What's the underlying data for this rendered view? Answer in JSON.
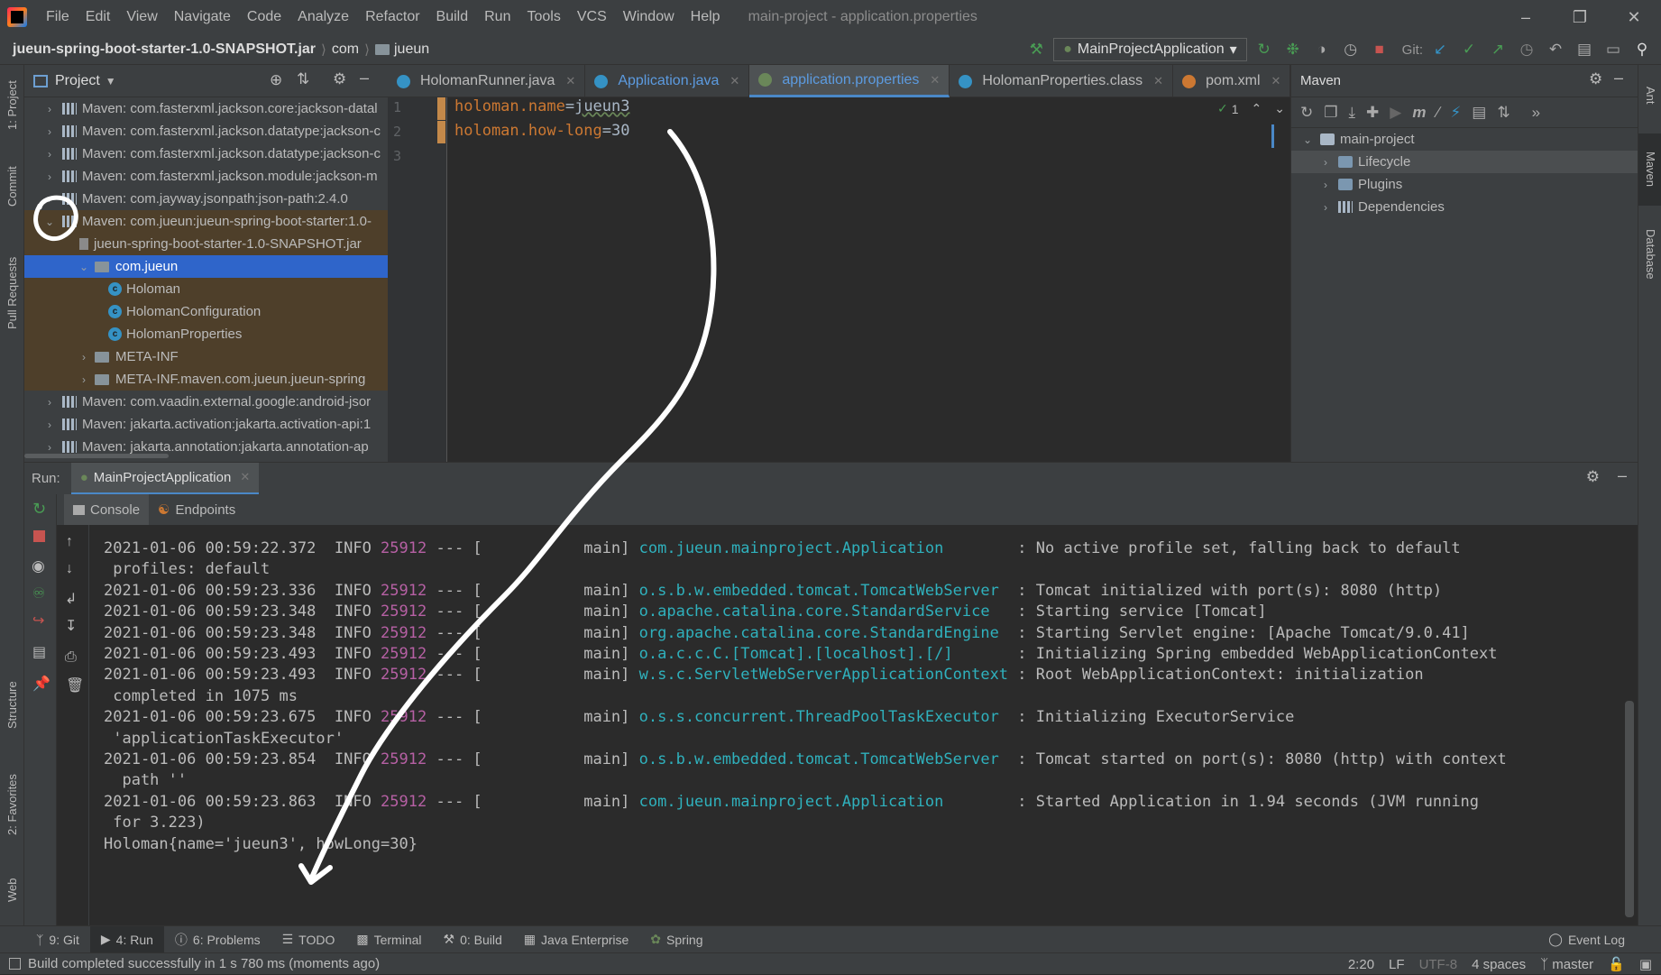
{
  "menubar": {
    "items": [
      "File",
      "Edit",
      "View",
      "Navigate",
      "Code",
      "Analyze",
      "Refactor",
      "Build",
      "Run",
      "Tools",
      "VCS",
      "Window",
      "Help"
    ],
    "window_title": "main-project - application.properties"
  },
  "navbar": {
    "crumbs": [
      "jueun-spring-boot-starter-1.0-SNAPSHOT.jar",
      "com",
      "jueun"
    ],
    "run_config": "MainProjectApplication",
    "git_label": "Git:"
  },
  "left_stripe": [
    "1: Project",
    "Commit",
    "Pull Requests",
    "Structure",
    "2: Favorites",
    "Web"
  ],
  "right_stripe": [
    "Ant",
    "Maven",
    "Database"
  ],
  "project": {
    "title": "Project",
    "rows": [
      {
        "text": "Maven: com.fasterxml.jackson.core:jackson-datal",
        "indent": 0,
        "type": "lib"
      },
      {
        "text": "Maven: com.fasterxml.jackson.datatype:jackson-c",
        "indent": 0,
        "type": "lib"
      },
      {
        "text": "Maven: com.fasterxml.jackson.datatype:jackson-c",
        "indent": 0,
        "type": "lib"
      },
      {
        "text": "Maven: com.fasterxml.jackson.module:jackson-m",
        "indent": 0,
        "type": "lib"
      },
      {
        "text": "Maven: com.jayway.jsonpath:json-path:2.4.0",
        "indent": 0,
        "type": "lib"
      },
      {
        "text": "Maven: com.jueun:jueun-spring-boot-starter:1.0-",
        "indent": 0,
        "type": "lib-open"
      },
      {
        "text": "jueun-spring-boot-starter-1.0-SNAPSHOT.jar",
        "indent": 1,
        "type": "jar"
      },
      {
        "text": "com.jueun",
        "indent": 2,
        "type": "folder-open"
      },
      {
        "text": "Holoman",
        "indent": 3,
        "type": "class"
      },
      {
        "text": "HolomanConfiguration",
        "indent": 3,
        "type": "class"
      },
      {
        "text": "HolomanProperties",
        "indent": 3,
        "type": "class"
      },
      {
        "text": "META-INF",
        "indent": 2,
        "type": "folder"
      },
      {
        "text": "META-INF.maven.com.jueun.jueun-spring",
        "indent": 2,
        "type": "folder"
      },
      {
        "text": "Maven: com.vaadin.external.google:android-jsor",
        "indent": 0,
        "type": "lib"
      },
      {
        "text": "Maven: jakarta.activation:jakarta.activation-api:1",
        "indent": 0,
        "type": "lib"
      },
      {
        "text": "Maven: jakarta.annotation:jakarta.annotation-ap",
        "indent": 0,
        "type": "lib"
      }
    ]
  },
  "tabs": [
    {
      "label": "HolomanRunner.java",
      "active": false
    },
    {
      "label": "Application.java",
      "active": false
    },
    {
      "label": "application.properties",
      "active": true
    },
    {
      "label": "HolomanProperties.class",
      "active": false
    },
    {
      "label": "pom.xml",
      "active": false
    }
  ],
  "editor": {
    "lines": [
      {
        "n": "1",
        "key": "holoman.name",
        "val": "jueun3"
      },
      {
        "n": "2",
        "key": "holoman.how-long",
        "val": "30"
      },
      {
        "n": "3",
        "key": "",
        "val": ""
      }
    ],
    "inspection": "1"
  },
  "maven": {
    "title": "Maven",
    "root": "main-project",
    "children": [
      "Lifecycle",
      "Plugins",
      "Dependencies"
    ]
  },
  "run": {
    "label": "Run:",
    "tab": "MainProjectApplication",
    "subtabs": [
      "Console",
      "Endpoints"
    ],
    "lines": [
      {
        "pre": "2021-01-06 00:59:22.372  INFO ",
        "pid": "25912",
        "mid": " --- [           main] ",
        "cls": "com.jueun.mainproject.Application       ",
        "msg": " : No active profile set, falling back to default"
      },
      {
        "plain": " profiles: default"
      },
      {
        "pre": "2021-01-06 00:59:23.336  INFO ",
        "pid": "25912",
        "mid": " --- [           main] ",
        "cls": "o.s.b.w.embedded.tomcat.TomcatWebServer ",
        "msg": " : Tomcat initialized with port(s): 8080 (http)"
      },
      {
        "pre": "2021-01-06 00:59:23.348  INFO ",
        "pid": "25912",
        "mid": " --- [           main] ",
        "cls": "o.apache.catalina.core.StandardService  ",
        "msg": " : Starting service [Tomcat]"
      },
      {
        "pre": "2021-01-06 00:59:23.348  INFO ",
        "pid": "25912",
        "mid": " --- [           main] ",
        "cls": "org.apache.catalina.core.StandardEngine ",
        "msg": " : Starting Servlet engine: [Apache Tomcat/9.0.41]"
      },
      {
        "pre": "2021-01-06 00:59:23.493  INFO ",
        "pid": "25912",
        "mid": " --- [           main] ",
        "cls": "o.a.c.c.C.[Tomcat].[localhost].[/]      ",
        "msg": " : Initializing Spring embedded WebApplicationContext"
      },
      {
        "pre": "2021-01-06 00:59:23.493  INFO ",
        "pid": "25912",
        "mid": " --- [           main] ",
        "cls": "w.s.c.ServletWebServerApplicationContext",
        "msg": " : Root WebApplicationContext: initialization"
      },
      {
        "plain": " completed in 1075 ms"
      },
      {
        "pre": "2021-01-06 00:59:23.675  INFO ",
        "pid": "25912",
        "mid": " --- [           main] ",
        "cls": "o.s.s.concurrent.ThreadPoolTaskExecutor ",
        "msg": " : Initializing ExecutorService"
      },
      {
        "plain": " 'applicationTaskExecutor'"
      },
      {
        "pre": "2021-01-06 00:59:23.854  INFO ",
        "pid": "25912",
        "mid": " --- [           main] ",
        "cls": "o.s.b.w.embedded.tomcat.TomcatWebServer ",
        "msg": " : Tomcat started on port(s): 8080 (http) with context"
      },
      {
        "plain": "  path ''"
      },
      {
        "pre": "2021-01-06 00:59:23.863  INFO ",
        "pid": "25912",
        "mid": " --- [           main] ",
        "cls": "com.jueun.mainproject.Application       ",
        "msg": " : Started Application in 1.94 seconds (JVM running"
      },
      {
        "plain": " for 3.223)"
      },
      {
        "plain": "Holoman{name='jueun3', howLong=30}"
      }
    ]
  },
  "toolwindows": [
    "9: Git",
    "4: Run",
    "6: Problems",
    "TODO",
    "Terminal",
    "0: Build",
    "Java Enterprise",
    "Spring"
  ],
  "event_log": "Event Log",
  "status": {
    "message": "Build completed successfully in 1 s 780 ms (moments ago)",
    "position": "2:20",
    "line_sep": "LF",
    "encoding": "UTF-8",
    "indent": "4 spaces",
    "branch": "master"
  },
  "colors": {
    "accent": "#4a88c7",
    "selection": "#2f65ca",
    "highlight": "#4e3f2a",
    "pid": "#b660a4",
    "logger": "#2fb1bd"
  }
}
